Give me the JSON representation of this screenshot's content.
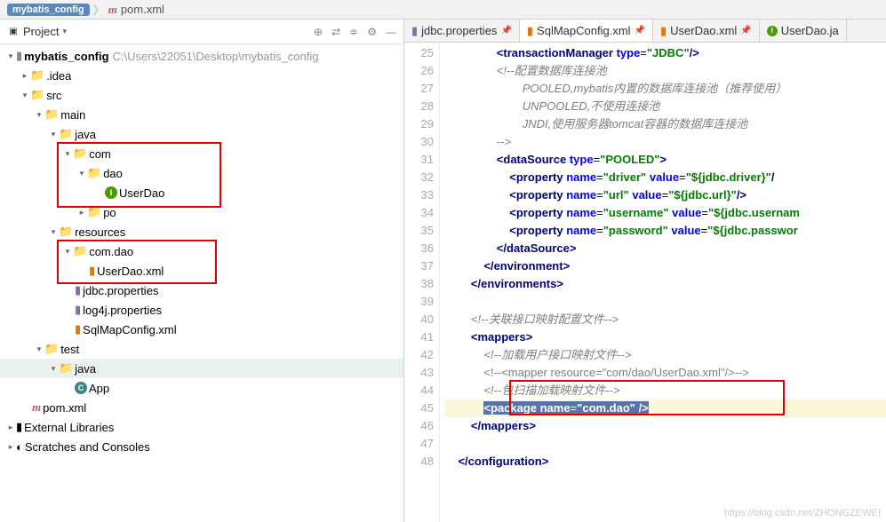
{
  "breadcrumb": {
    "project": "mybatis_config",
    "file": "pom.xml"
  },
  "project_panel": {
    "title": "Project"
  },
  "tree": {
    "root": {
      "name": "mybatis_config",
      "path": "C:\\Users\\22051\\Desktop\\mybatis_config"
    },
    "idea": ".idea",
    "src": "src",
    "main": "main",
    "java": "java",
    "com": "com",
    "dao": "dao",
    "userdao": "UserDao",
    "po": "po",
    "resources": "resources",
    "comdao": "com.dao",
    "userdaoxml": "UserDao.xml",
    "jdbcprop": "jdbc.properties",
    "log4jprop": "log4j.properties",
    "sqlmap": "SqlMapConfig.xml",
    "test": "test",
    "java2": "java",
    "app": "App",
    "pom": "pom.xml",
    "extlib": "External Libraries",
    "scratches": "Scratches and Consoles"
  },
  "tabs": [
    {
      "label": "jdbc.properties",
      "type": "prop"
    },
    {
      "label": "SqlMapConfig.xml",
      "type": "xml",
      "active": true
    },
    {
      "label": "UserDao.xml",
      "type": "xml"
    },
    {
      "label": "UserDao.ja",
      "type": "iface"
    }
  ],
  "code": {
    "lines": [
      25,
      26,
      27,
      28,
      29,
      30,
      31,
      32,
      33,
      34,
      35,
      36,
      37,
      38,
      39,
      40,
      41,
      42,
      43,
      44,
      45,
      46,
      47,
      48
    ],
    "l25a": "<",
    "l25b": "transactionManager",
    "l25c": " ",
    "l25d": "type",
    "l25e": "=",
    "l25f": "\"JDBC\"",
    "l25g": "/>",
    "l26": "<!--配置数据库连接池",
    "l27": "POOLED,mybatis内置的数据库连接池（推荐使用）",
    "l28": "UNPOOLED,不使用连接池",
    "l29": "JNDI,使用服务器tomcat容器的数据库连接池",
    "l30": "-->",
    "l31a": "<",
    "l31b": "dataSource",
    "l31c": " ",
    "l31d": "type",
    "l31e": "=",
    "l31f": "\"POOLED\"",
    "l31g": ">",
    "l32a": "<",
    "l32b": "property",
    "l32c": " ",
    "l32d": "name",
    "l32e": "=",
    "l32f": "\"driver\"",
    "l32g": " ",
    "l32h": "value",
    "l32i": "=",
    "l32j": "\"${jdbc.driver}\"",
    "l32k": "/",
    "l33a": "<",
    "l33b": "property",
    "l33c": " ",
    "l33d": "name",
    "l33e": "=",
    "l33f": "\"url\"",
    "l33g": " ",
    "l33h": "value",
    "l33i": "=",
    "l33j": "\"${jdbc.url}\"",
    "l33k": "/>",
    "l34a": "<",
    "l34b": "property",
    "l34c": " ",
    "l34d": "name",
    "l34e": "=",
    "l34f": "\"username\"",
    "l34g": " ",
    "l34h": "value",
    "l34i": "=",
    "l34j": "\"${jdbc.usernam",
    "l35a": "<",
    "l35b": "property",
    "l35c": " ",
    "l35d": "name",
    "l35e": "=",
    "l35f": "\"password\"",
    "l35g": " ",
    "l35h": "value",
    "l35i": "=",
    "l35j": "\"${jdbc.passwor",
    "l36a": "</",
    "l36b": "dataSource",
    "l36c": ">",
    "l37a": "</",
    "l37b": "environment",
    "l37c": ">",
    "l38a": "</",
    "l38b": "environments",
    "l38c": ">",
    "l40": "<!--关联接口映射配置文件-->",
    "l41a": "<",
    "l41b": "mappers",
    "l41c": ">",
    "l42": "<!--加载用户接口映射文件-->",
    "l43": "<!--<mapper resource=\"com/dao/UserDao.xml\"/>-->",
    "l44": "<!--包扫描加载映射文件-->",
    "l45a": "<",
    "l45b": "package",
    "l45c": " ",
    "l45d": "name",
    "l45e": "=",
    "l45f": "\"com.dao\"",
    "l45g": " />",
    "l46a": "</",
    "l46b": "mappers",
    "l46c": ">",
    "l48a": "</",
    "l48b": "configuration",
    "l48c": ">"
  },
  "watermark": "https://blog.csdn.net/ZHONGZEWEI"
}
